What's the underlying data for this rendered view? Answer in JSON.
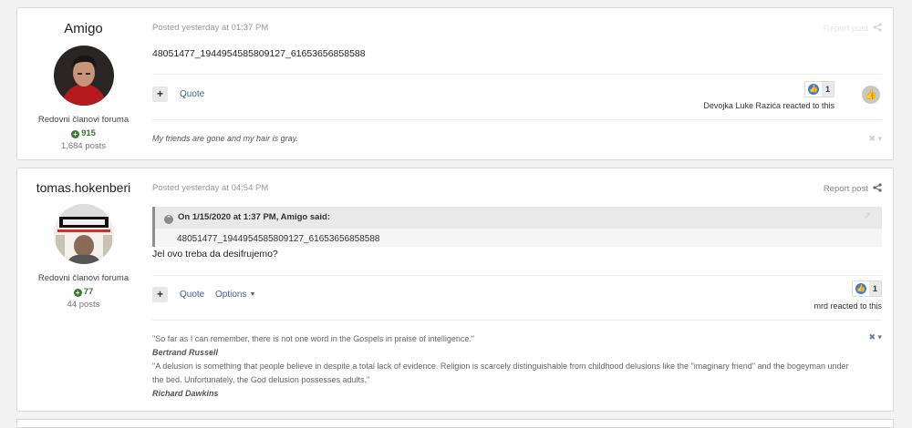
{
  "posts": [
    {
      "author": "Amigo",
      "group": "Redovni članovi foruma",
      "reputation": "915",
      "post_count": "1,684 posts",
      "posted": "Posted yesterday at 01:37 PM",
      "report": "Report post",
      "content": "48051477_1944954585809127_61653656858588",
      "quote_label": "Quote",
      "reaction_count": "1",
      "reacted_text": "Devojka Luke Razića reacted to this",
      "signature": "My friends are gone and my hair is gray."
    },
    {
      "author": "tomas.hokenberi",
      "group": "Redovni članovi foruma",
      "reputation": "77",
      "post_count": "44 posts",
      "posted": "Posted yesterday at 04:54 PM",
      "report": "Report post",
      "quote_cite": "On 1/15/2020 at 1:37 PM, Amigo said:",
      "quote_text": "48051477_1944954585809127_61653656858588",
      "content": "Jel ovo treba da desifrujemo?",
      "quote_label": "Quote",
      "options_label": "Options",
      "reaction_count": "1",
      "reacted_text": "mrd reacted to this",
      "signature_lines": [
        "\"So far as I can remember, there is not one word in the Gospels in praise of intelligence.\"",
        "Bertrand Russell",
        "\"A delusion is something that people believe in despite a total lack of evidence. Religion is scarcely distinguishable from childhood delusions like the \"imaginary friend\" and the bogeyman under the bed. Unfortunately, the God delusion possesses adults.\"",
        "Richard Dawkins"
      ]
    }
  ],
  "icons": {
    "share": "share-icon",
    "reputation": "plus-circle-icon",
    "like": "thumbs-up-icon",
    "dismiss": "close-icon"
  },
  "colors": {
    "link": "#3d6594",
    "like": "#3e7bd6",
    "reputation": "#3a7a2e"
  }
}
